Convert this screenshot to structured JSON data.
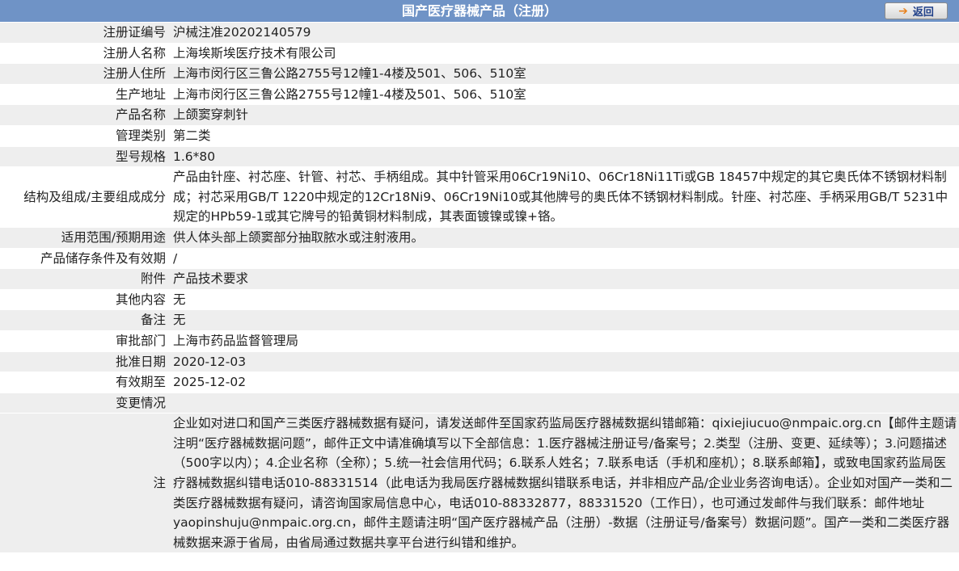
{
  "header": {
    "title": "国产医疗器械产品（注册）",
    "back_label": "返回",
    "back_icon": "arrow-right-icon"
  },
  "rows": [
    {
      "label": "注册证编号",
      "value": "沪械注准20202140579"
    },
    {
      "label": "注册人名称",
      "value": "上海埃斯埃医疗技术有限公司"
    },
    {
      "label": "注册人住所",
      "value": "上海市闵行区三鲁公路2755号12幢1-4楼及501、506、510室"
    },
    {
      "label": "生产地址",
      "value": "上海市闵行区三鲁公路2755号12幢1-4楼及501、506、510室"
    },
    {
      "label": "产品名称",
      "value": "上颌窦穿刺针"
    },
    {
      "label": "管理类别",
      "value": "第二类"
    },
    {
      "label": "型号规格",
      "value": "1.6*80"
    },
    {
      "label": "结构及组成/主要组成成分",
      "value": "产品由针座、衬芯座、针管、衬芯、手柄组成。其中针管采用06Cr19Ni10、06Cr18Ni11Ti或GB 18457中规定的其它奥氏体不锈钢材料制成；衬芯采用GB/T 1220中规定的12Cr18Ni9、06Cr19Ni10或其他牌号的奥氏体不锈钢材料制成。针座、衬芯座、手柄采用GB/T 5231中规定的HPb59-1或其它牌号的铅黄铜材料制成，其表面镀镍或镍+铬。"
    },
    {
      "label": "适用范围/预期用途",
      "value": "供人体头部上颌窦部分抽取脓水或注射液用。"
    },
    {
      "label": "产品储存条件及有效期",
      "value": "/"
    },
    {
      "label": "附件",
      "value": "产品技术要求"
    },
    {
      "label": "其他内容",
      "value": "无"
    },
    {
      "label": "备注",
      "value": "无"
    },
    {
      "label": "审批部门",
      "value": "上海市药品监督管理局"
    },
    {
      "label": "批准日期",
      "value": "2020-12-03"
    },
    {
      "label": "有效期至",
      "value": "2025-12-02"
    },
    {
      "label": "变更情况",
      "value": ""
    }
  ],
  "note": {
    "label": "注",
    "text": "企业如对进口和国产三类医疗器械数据有疑问，请发送邮件至国家药监局医疗器械数据纠错邮箱：qixiejiucuo@nmpaic.org.cn【邮件主题请注明“医疗器械数据问题”，邮件正文中请准确填写以下全部信息：1.医疗器械注册证号/备案号；2.类型（注册、变更、延续等）；3.问题描述（500字以内）；4.企业名称（全称）；5.统一社会信用代码；6.联系人姓名；7.联系电话（手机和座机）；8.联系邮箱】，或致电国家药监局医疗器械数据纠错电话010-88331514（此电话为我局医疗器械数据纠错联系电话，并非相应产品/企业业务咨询电话）。企业如对国产一类和二类医疗器械数据有疑问，请咨询国家局信息中心，电话010-88332877，88331520（工作日），也可通过发邮件与我们联系：邮件地址yaopinshuju@nmpaic.org.cn，邮件主题请注明“国产医疗器械产品（注册）-数据（注册证号/备案号）数据问题”。国产一类和二类医疗器械数据来源于省局，由省局通过数据共享平台进行纠错和维护。"
  },
  "colors": {
    "header_bg": "#6f93c6",
    "row_alt": "#eeeeee",
    "button_text": "#1f3f88",
    "arrow": "#e8821e"
  }
}
